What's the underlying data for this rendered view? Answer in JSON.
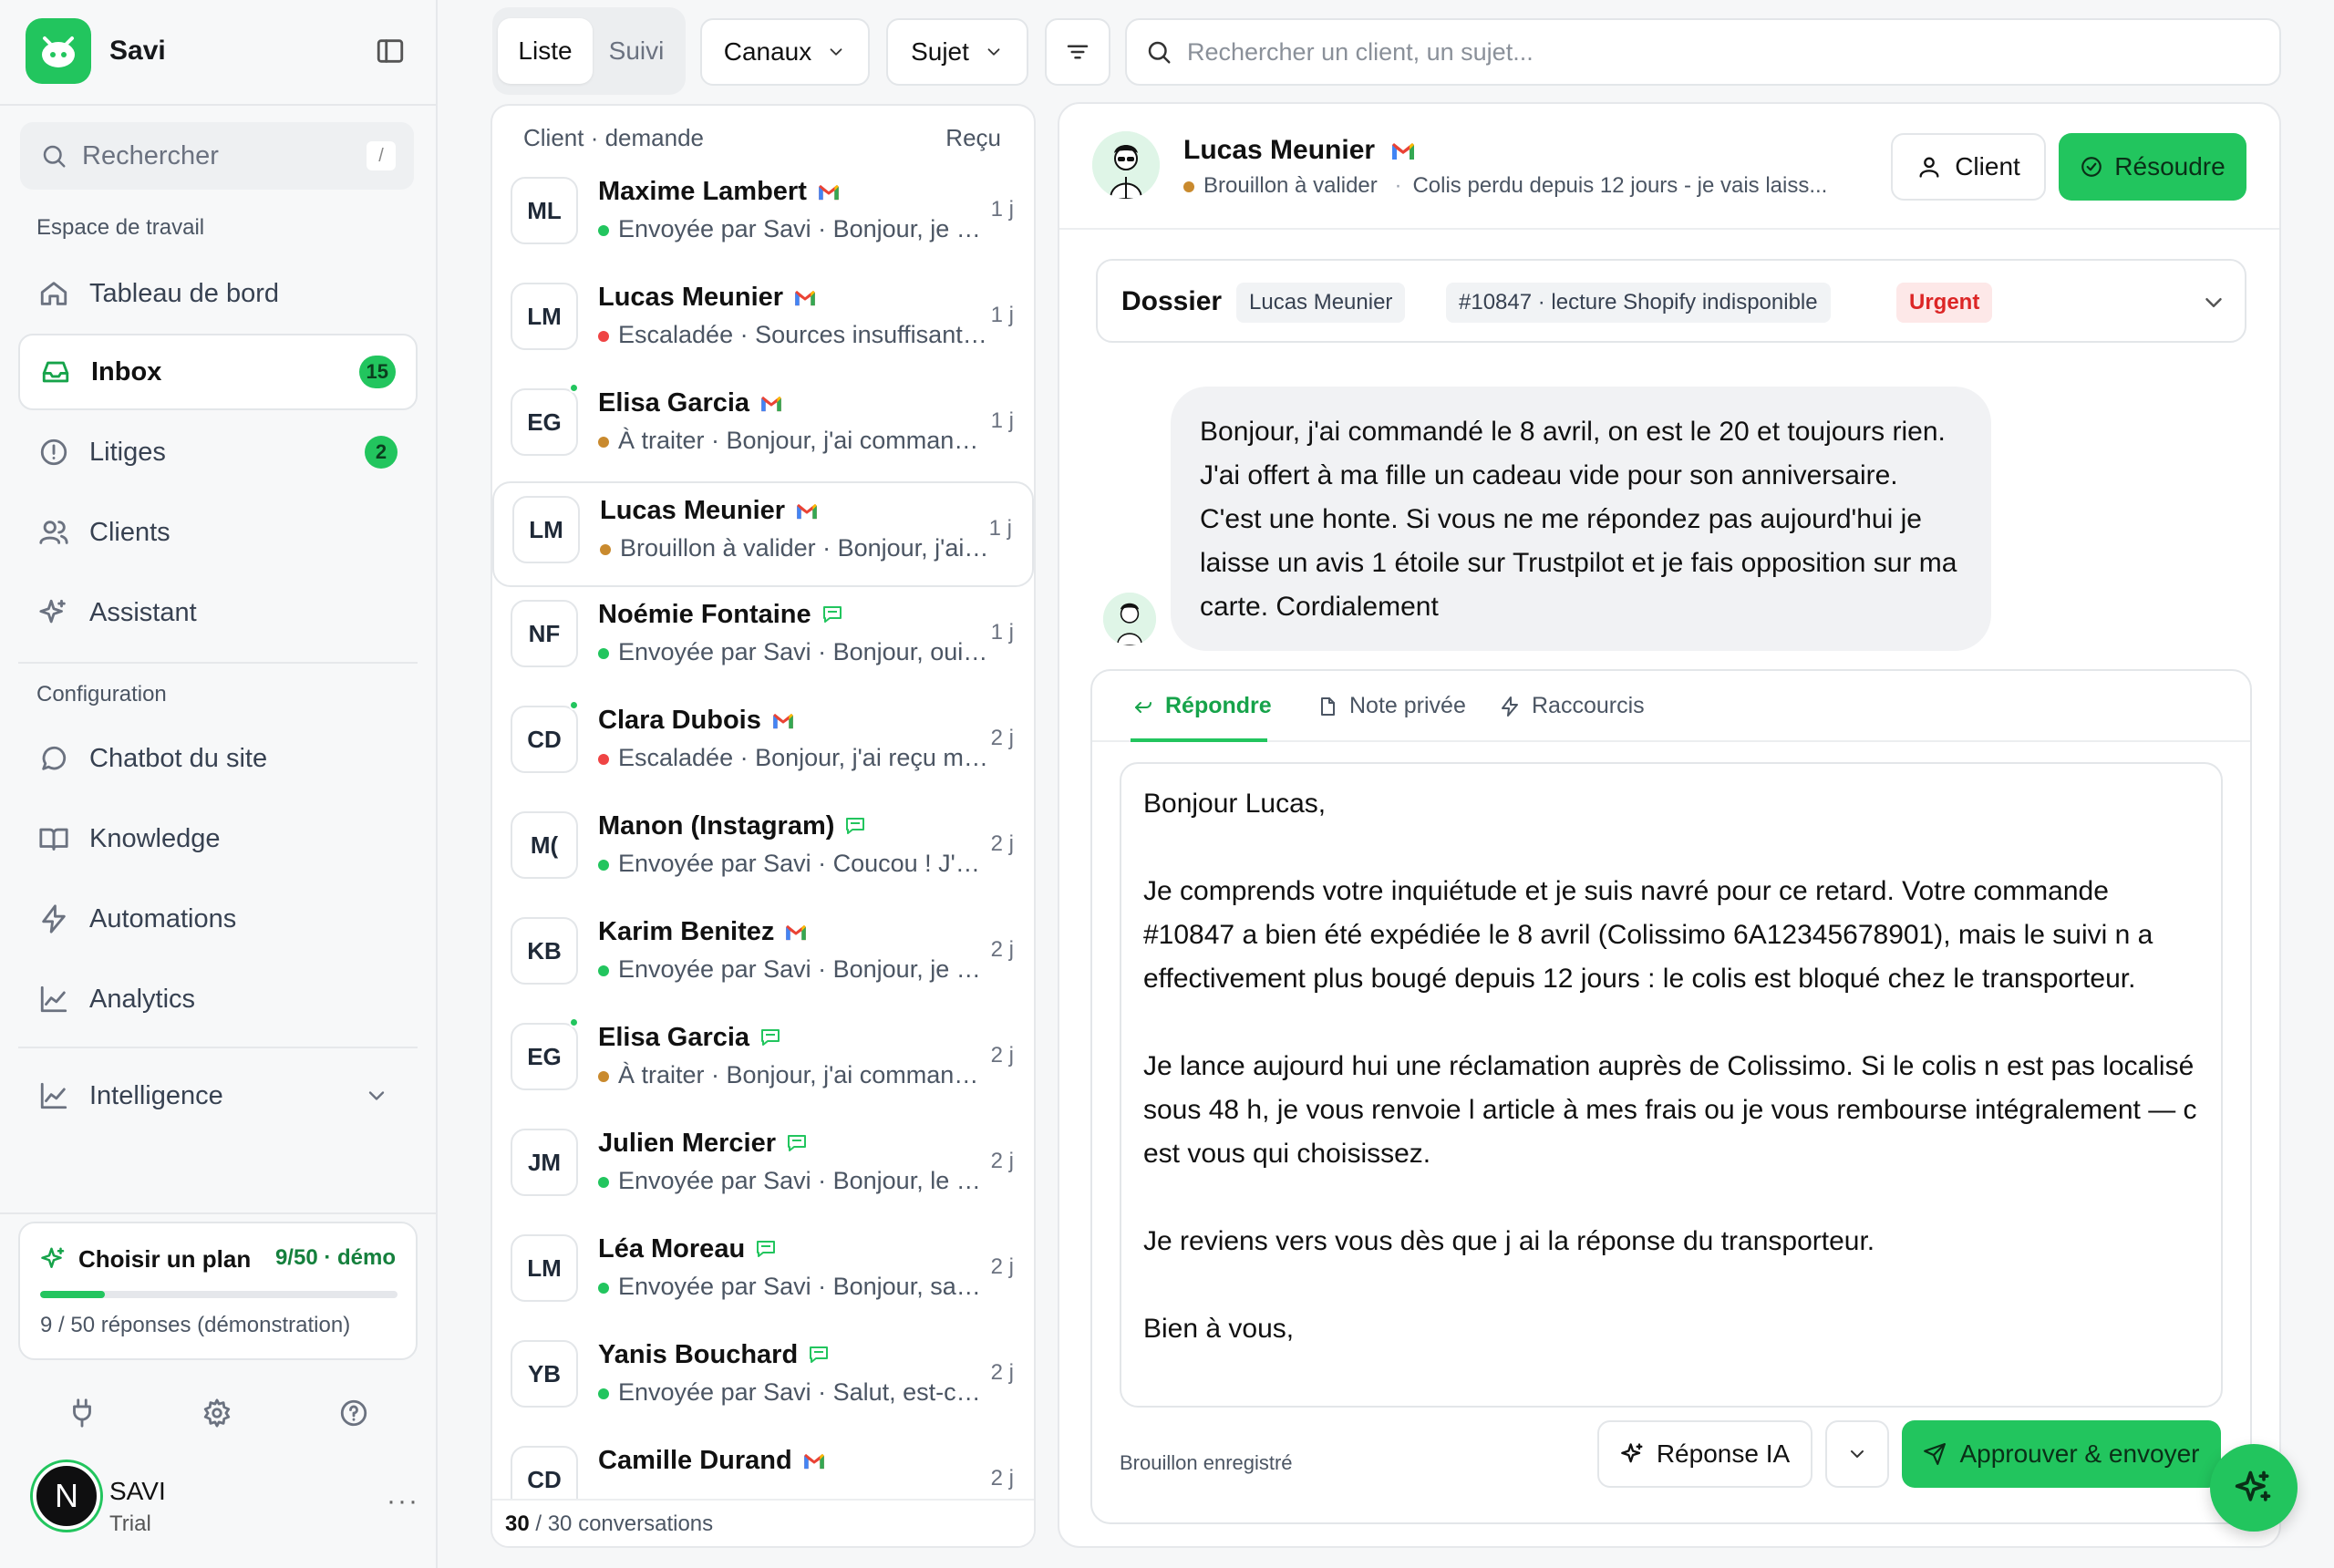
{
  "app": {
    "name": "Savi"
  },
  "sidebar": {
    "search_label": "Rechercher",
    "search_shortcut": "/",
    "workspace_label": "Espace de travail",
    "workspace_items": [
      {
        "label": "Tableau de bord",
        "icon": "home-icon"
      },
      {
        "label": "Inbox",
        "icon": "inbox-icon",
        "badge": "15",
        "active": true
      },
      {
        "label": "Litiges",
        "icon": "alert-circle-icon",
        "badge": "2"
      },
      {
        "label": "Clients",
        "icon": "users-icon"
      },
      {
        "label": "Assistant",
        "icon": "sparkles-icon"
      }
    ],
    "config_label": "Configuration",
    "config_items": [
      {
        "label": "Chatbot du site",
        "icon": "chat-bubble-icon"
      },
      {
        "label": "Knowledge",
        "icon": "book-icon"
      },
      {
        "label": "Automations",
        "icon": "bolt-icon"
      },
      {
        "label": "Analytics",
        "icon": "chart-line-icon"
      }
    ],
    "intelligence_label": "Intelligence",
    "plan": {
      "title": "Choisir un plan",
      "count": "9/50 · démo",
      "progress": 0.18,
      "subtitle": "9 / 50 réponses (démonstration)"
    },
    "user": {
      "initial": "N",
      "name": "SAVI",
      "plan": "Trial"
    }
  },
  "toolbar": {
    "tabs": [
      "Liste",
      "Suivi"
    ],
    "channels_label": "Canaux",
    "subject_label": "Sujet",
    "search_placeholder": "Rechercher un client, un sujet..."
  },
  "list": {
    "header_left": "Client · demande",
    "header_right": "Reçu",
    "conversations": [
      {
        "initials": "ML",
        "name": "Maxime Lambert",
        "channel": "gmail",
        "status_color": "#22c55e",
        "meta": "Envoyée par Savi · Bonjour, je vous confirme...",
        "time": "1 j",
        "online": false
      },
      {
        "initials": "LM",
        "name": "Lucas Meunier",
        "channel": "gmail",
        "status_color": "#ef4444",
        "meta": "Escaladée · Sources insuffisantes · Bonjour",
        "time": "1 j",
        "online": false
      },
      {
        "initials": "EG",
        "name": "Elisa Garcia",
        "channel": "gmail",
        "status_color": "#c98a2e",
        "meta": "À traiter · Bonjour, j'ai commandé...",
        "time": "1 j",
        "online": true
      },
      {
        "initials": "LM",
        "name": "Lucas Meunier",
        "channel": "gmail",
        "status_color": "#c98a2e",
        "meta": "Brouillon à valider · Bonjour, j'ai commandé...",
        "time": "1 j",
        "online": false,
        "selected": true
      },
      {
        "initials": "NF",
        "name": "Noémie Fontaine",
        "channel": "chat",
        "status_color": "#22c55e",
        "meta": "Envoyée par Savi · Bonjour, oui bien sûr...",
        "time": "1 j",
        "online": false
      },
      {
        "initials": "CD",
        "name": "Clara Dubois",
        "channel": "gmail",
        "status_color": "#ef4444",
        "meta": "Escaladée · Bonjour, j'ai reçu mon colis...",
        "time": "2 j",
        "online": true
      },
      {
        "initials": "M(",
        "name": "Manon (Instagram)",
        "channel": "chat",
        "status_color": "#22c55e",
        "meta": "Envoyée par Savi · Coucou ! J'espère...",
        "time": "2 j",
        "online": false
      },
      {
        "initials": "KB",
        "name": "Karim Benitez",
        "channel": "gmail",
        "status_color": "#22c55e",
        "meta": "Envoyée par Savi · Bonjour, je vous confirme...",
        "time": "2 j",
        "online": false
      },
      {
        "initials": "EG",
        "name": "Elisa Garcia",
        "channel": "chat",
        "status_color": "#c98a2e",
        "meta": "À traiter · Bonjour, j'ai commandé...",
        "time": "2 j",
        "online": true
      },
      {
        "initials": "JM",
        "name": "Julien Mercier",
        "channel": "chat",
        "status_color": "#22c55e",
        "meta": "Envoyée par Savi · Bonjour, le suivi...",
        "time": "2 j",
        "online": false
      },
      {
        "initials": "LM",
        "name": "Léa Moreau",
        "channel": "chat",
        "status_color": "#22c55e",
        "meta": "Envoyée par Savi · Bonjour, sans souci...",
        "time": "2 j",
        "online": false
      },
      {
        "initials": "YB",
        "name": "Yanis Bouchard",
        "channel": "chat",
        "status_color": "#22c55e",
        "meta": "Envoyée par Savi · Salut, est-ce que...",
        "time": "2 j",
        "online": false
      },
      {
        "initials": "CD",
        "name": "Camille Durand",
        "channel": "gmail",
        "status_color": "#22c55e",
        "meta": "",
        "time": "2 j",
        "online": false
      }
    ],
    "footer_count": "30",
    "footer_text": " / 30 conversations"
  },
  "detail": {
    "name": "Lucas Meunier",
    "status": "Brouillon à valider",
    "subject": "Colis perdu depuis 12 jours - je vais laiss...",
    "client_button": "Client",
    "resolve_button": "Résoudre",
    "dossier": {
      "title": "Dossier",
      "chips": [
        "Lucas Meunier",
        "#10847 · lecture Shopify indisponible"
      ],
      "urgent": "Urgent"
    },
    "customer_message": "Bonjour, j'ai commandé le 8 avril, on est le 20 et toujours rien. J'ai offert à ma fille un cadeau vide pour son anniversaire. C'est une honte. Si vous ne me répondez pas aujourd'hui je laisse un avis 1 étoile sur Trustpilot et je fais opposition sur ma carte. Cordialement",
    "composer": {
      "tabs": [
        "Répondre",
        "Note privée",
        "Raccourcis"
      ],
      "draft_paragraphs": [
        "Bonjour Lucas,",
        "Je comprends votre inquiétude et je suis navré pour ce retard. Votre commande #10847 a bien été expédiée le 8 avril (Colissimo 6A12345678901), mais le suivi n a effectivement plus bougé depuis 12 jours : le colis est bloqué chez le transporteur.",
        "Je lance aujourd hui une réclamation auprès de Colissimo. Si le colis n est pas localisé sous 48 h, je vous renvoie l article à mes frais ou je vous rembourse intégralement — c est vous qui choisissez.",
        "Je reviens vers vous dès que j ai la réponse du transporteur.",
        "Bien à vous,"
      ],
      "saved_label": "Brouillon enregistré",
      "ai_button": "Réponse IA",
      "send_button": "Approuver & envoyer"
    }
  },
  "colors": {
    "accent": "#22c55e",
    "urgent": "#dc2626",
    "draft": "#c98a2e"
  }
}
